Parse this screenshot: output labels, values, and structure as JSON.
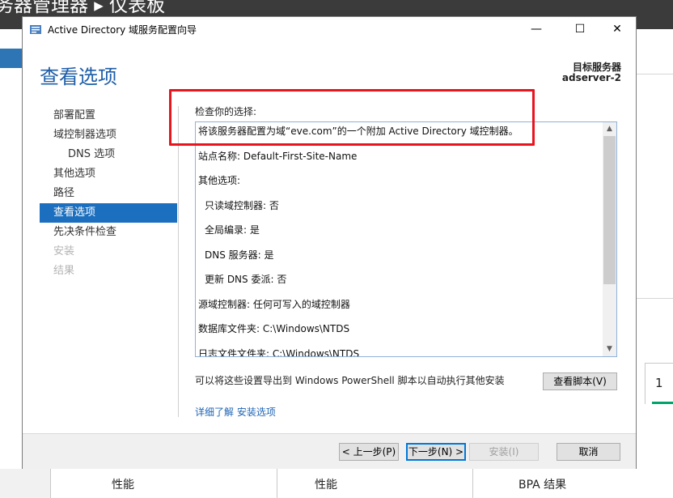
{
  "background": {
    "title": "务器管理器 ▸ 仪表板",
    "tile_count": "1",
    "columns": [
      "性能",
      "性能",
      "BPA 结果"
    ]
  },
  "window": {
    "title": "Active Directory 域服务配置向导",
    "minimize": "—",
    "maximize": "☐",
    "close": "✕"
  },
  "page": {
    "title": "查看选项",
    "target_label": "目标服务器",
    "target_name": "adserver-2"
  },
  "nav": [
    {
      "label": "部署配置",
      "state": "normal"
    },
    {
      "label": "域控制器选项",
      "state": "normal"
    },
    {
      "label": "DNS 选项",
      "state": "sub"
    },
    {
      "label": "其他选项",
      "state": "normal"
    },
    {
      "label": "路径",
      "state": "normal"
    },
    {
      "label": "查看选项",
      "state": "active"
    },
    {
      "label": "先决条件检查",
      "state": "normal"
    },
    {
      "label": "安装",
      "state": "disabled"
    },
    {
      "label": "结果",
      "state": "disabled"
    }
  ],
  "review": {
    "label": "检查你的选择:",
    "lines": [
      "将该服务器配置为域“eve.com”的一个附加 Active Directory 域控制器。",
      "站点名称: Default-First-Site-Name",
      "其他选项:",
      "只读域控制器: 否",
      "全局编录: 是",
      "DNS 服务器: 是",
      "更新 DNS 委派: 否",
      "源域控制器: 任何可写入的域控制器",
      "数据库文件夹: C:\\Windows\\NTDS",
      "日志文件文件夹: C:\\Windows\\NTDS"
    ]
  },
  "export": {
    "text": "可以将这些设置导出到 Windows PowerShell 脚本以自动执行其他安装",
    "button": "查看脚本(V)"
  },
  "learn_more": "详细了解 安装选项",
  "footer": {
    "prev": "< 上一步(P)",
    "next": "下一步(N) >",
    "install": "安装(I)",
    "cancel": "取消"
  },
  "colors": {
    "accent": "#1c6fbe",
    "title": "#1e5ea8",
    "annotation": "#e8141e"
  }
}
